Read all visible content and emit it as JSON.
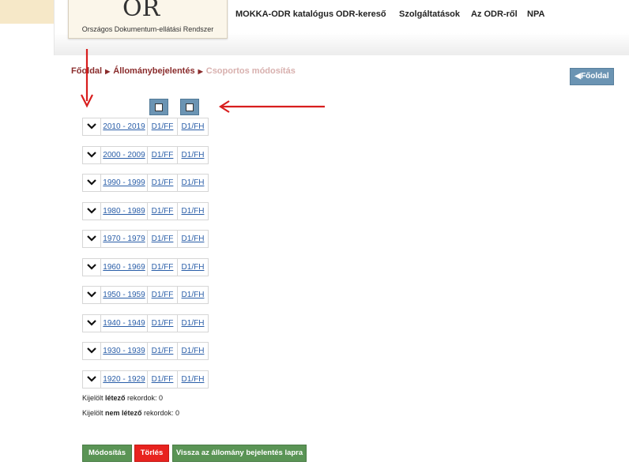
{
  "header": {
    "logo_mark": "OR",
    "logo_text": "Országos Dokumentum-ellátási Rendszer",
    "nav": [
      "MOKKA-ODR katalógus",
      "ODR-kereső",
      "Szolgáltatások",
      "Az ODR-ről",
      "NPA"
    ]
  },
  "breadcrumb": {
    "home": "Főoldal",
    "section": "Állománybejelentés",
    "current": "Csoportos módosítás"
  },
  "home_button": "Főoldal",
  "icons": {
    "back_arrow": "caret-left-icon",
    "row_toggle": "chevron-down-icon",
    "checkbox": "checkbox-icon"
  },
  "rows": [
    {
      "period": "2010 - 2019",
      "c1": "D1/FF",
      "c2": "D1/FH"
    },
    {
      "period": "2000 - 2009",
      "c1": "D1/FF",
      "c2": "D1/FH"
    },
    {
      "period": "1990 - 1999",
      "c1": "D1/FF",
      "c2": "D1/FH"
    },
    {
      "period": "1980 - 1989",
      "c1": "D1/FF",
      "c2": "D1/FH"
    },
    {
      "period": "1970 - 1979",
      "c1": "D1/FF",
      "c2": "D1/FH"
    },
    {
      "period": "1960 - 1969",
      "c1": "D1/FF",
      "c2": "D1/FH"
    },
    {
      "period": "1950 - 1959",
      "c1": "D1/FF",
      "c2": "D1/FH"
    },
    {
      "period": "1940 - 1949",
      "c1": "D1/FF",
      "c2": "D1/FH"
    },
    {
      "period": "1930 - 1939",
      "c1": "D1/FF",
      "c2": "D1/FH"
    },
    {
      "period": "1920 - 1929",
      "c1": "D1/FF",
      "c2": "D1/FH"
    }
  ],
  "info": {
    "existing_prefix": "Kijelölt ",
    "existing_bold": "létező",
    "existing_suffix": " rekordok: 0",
    "nonexisting_prefix": "Kijelölt ",
    "nonexisting_bold": "nem létező",
    "nonexisting_suffix": " rekordok: 0"
  },
  "buttons": {
    "modify": "Módosítás",
    "delete": "Törlés",
    "back": "Vissza az állomány bejelentés lapra"
  },
  "colors": {
    "accent_blue": "#6b94b3",
    "breadcrumb_link": "#8a2c2c",
    "button_green": "#5a9455",
    "button_red": "#e8231f",
    "annotation_red": "#d81e1e"
  }
}
